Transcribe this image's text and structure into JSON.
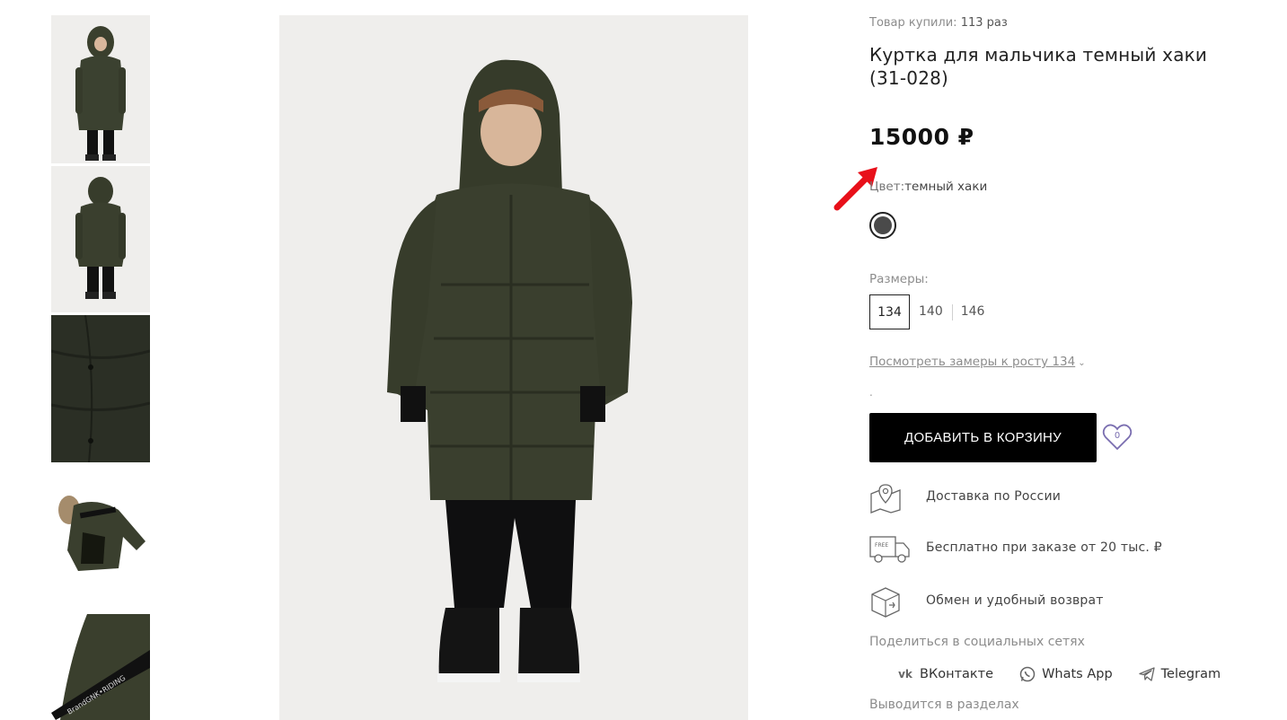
{
  "gallery": {
    "thumbs": [
      "thumb-front",
      "thumb-back",
      "thumb-fabric-detail",
      "thumb-jacket-flat",
      "thumb-hood-detail"
    ],
    "hood_tape_text": "BrandGNK•RIDING"
  },
  "product": {
    "bought_label": "Товар купили:",
    "bought_count": "113 раз",
    "title": "Куртка для мальчика темный хаки (31-028)",
    "price": "15000 ₽",
    "color_label": "Цвет:",
    "color_value": "темный хаки",
    "swatch_color": "#4a4a4a",
    "sizes_label": "Размеры:",
    "sizes": [
      "134",
      "140",
      "146"
    ],
    "selected_size": "134",
    "measure_link": "Посмотреть замеры к росту 134",
    "dot": ".",
    "cart_button": "ДОБАВИТЬ В КОРЗИНУ",
    "wishlist_count": "0"
  },
  "features": [
    {
      "icon": "map-pin-icon",
      "text": "Доставка по России"
    },
    {
      "icon": "free-truck-icon",
      "text": "Бесплатно при заказе от 20 тыс. ₽"
    },
    {
      "icon": "return-box-icon",
      "text": "Обмен и удобный возврат"
    }
  ],
  "share": {
    "label": "Поделиться в социальных сетях",
    "items": [
      {
        "icon": "vk-icon",
        "label": "ВКонтакте"
      },
      {
        "icon": "whatsapp-icon",
        "label": "Whats App"
      },
      {
        "icon": "telegram-icon",
        "label": "Telegram"
      }
    ]
  },
  "sections_label": "Выводится в разделах",
  "colors": {
    "button_bg": "#000000",
    "annotation_arrow": "#e8101a",
    "heart": "#7a6eb0"
  }
}
